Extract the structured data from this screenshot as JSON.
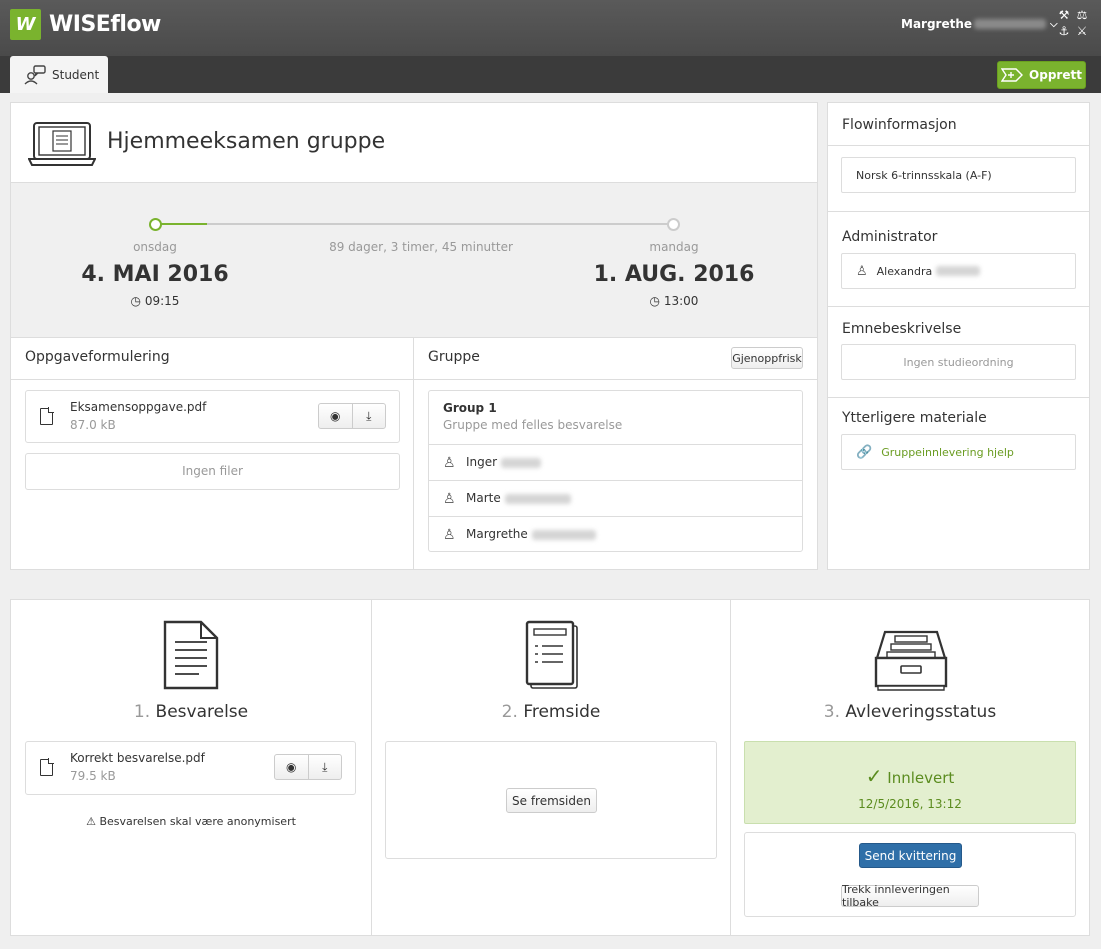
{
  "app": {
    "logo_mark": "W",
    "logo_text": "WISEflow"
  },
  "user": {
    "first_name": "Margrethe",
    "chevron": "⌵"
  },
  "tools": {
    "icons": [
      "⚒",
      "⚖",
      "⚓",
      "⚔"
    ]
  },
  "tabs": {
    "student_label": "Student"
  },
  "create_button": {
    "label": "Opprett"
  },
  "exam": {
    "title": "Hjemmeeksamen gruppe",
    "start": {
      "day": "onsdag",
      "date": "4. MAI 2016",
      "time": "09:15"
    },
    "end": {
      "day": "mandag",
      "date": "1. AUG. 2016",
      "time": "13:00"
    },
    "duration": "89 dager, 3 timer, 45 minutter",
    "progress": 0.09
  },
  "assignment": {
    "heading": "Oppgaveformulering",
    "file": {
      "name": "Eksamensoppgave.pdf",
      "size": "87.0 kB"
    },
    "no_files": "Ingen filer"
  },
  "group": {
    "heading": "Gruppe",
    "refresh_label": "Gjenoppfrisk",
    "name": "Group 1",
    "subtitle": "Gruppe med felles besvarelse",
    "members": [
      {
        "first_name": "Inger"
      },
      {
        "first_name": "Marte"
      },
      {
        "first_name": "Margrethe"
      }
    ]
  },
  "sidebar": {
    "flow_title": "Flowinformasjon",
    "grading_scale": "Norsk 6-trinnsskala (A-F)",
    "admin_title": "Administrator",
    "admin_first_name": "Alexandra",
    "course_title": "Emnebeskrivelse",
    "course_value": "Ingen studieordning",
    "material_title": "Ytterligere materiale",
    "material_link": "Gruppeinnlevering hjelp"
  },
  "steps": {
    "answer": {
      "num": "1.",
      "title": "Besvarelse",
      "file": {
        "name": "Korrekt besvarelse.pdf",
        "size": "79.5 kB"
      },
      "warning": "Besvarelsen skal være anonymisert"
    },
    "front": {
      "num": "2.",
      "title": "Fremside",
      "button": "Se fremsiden"
    },
    "status": {
      "num": "3.",
      "title": "Avleveringsstatus",
      "state": "Innlevert",
      "datetime": "12/5/2016, 13:12",
      "receipt_button": "Send kvittering",
      "withdraw_button": "Trekk innleveringen tilbake"
    }
  },
  "colors": {
    "brand_green": "#7ab32e",
    "primary_blue": "#2f6fa8",
    "success_bg": "#e3efcf"
  }
}
